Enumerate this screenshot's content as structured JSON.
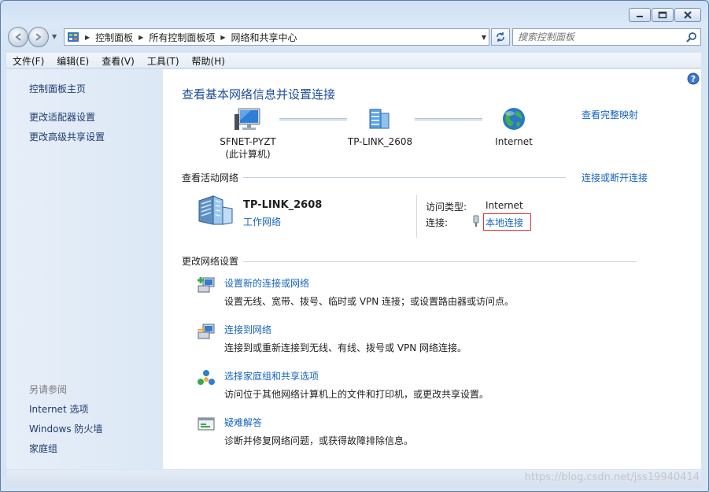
{
  "window": {
    "caption_buttons": [
      "minimize",
      "maximize",
      "close"
    ]
  },
  "address": {
    "crumbs": [
      "控制面板",
      "所有控制面板项",
      "网络和共享中心"
    ],
    "search_placeholder": "搜索控制面板"
  },
  "menu": [
    "文件(F)",
    "编辑(E)",
    "查看(V)",
    "工具(T)",
    "帮助(H)"
  ],
  "sidebar": {
    "links": [
      "控制面板主页",
      "更改适配器设置",
      "更改高级共享设置"
    ],
    "see_also_label": "另请参阅",
    "see_also": [
      "Internet 选项",
      "Windows 防火墙",
      "家庭组"
    ]
  },
  "main": {
    "title": "查看基本网络信息并设置连接",
    "full_map_link": "查看完整映射",
    "map": {
      "computer_name": "SFNET-PYZT",
      "computer_sub": "(此计算机)",
      "network_name": "TP-LINK_2608",
      "internet_label": "Internet"
    },
    "active": {
      "heading": "查看活动网络",
      "connect_link": "连接或断开连接",
      "network_name": "TP-LINK_2608",
      "network_type": "工作网络",
      "access_type_label": "访问类型:",
      "access_type_value": "Internet",
      "connections_label": "连接:",
      "connection_link": "本地连接"
    },
    "change": {
      "heading": "更改网络设置",
      "tasks": [
        {
          "title": "设置新的连接或网络",
          "desc": "设置无线、宽带、拨号、临时或 VPN 连接；或设置路由器或访问点。"
        },
        {
          "title": "连接到网络",
          "desc": "连接到或重新连接到无线、有线、拨号或 VPN 网络连接。"
        },
        {
          "title": "选择家庭组和共享选项",
          "desc": "访问位于其他网络计算机上的文件和打印机，或更改共享设置。"
        },
        {
          "title": "疑难解答",
          "desc": "诊断并修复网络问题，或获得故障排除信息。"
        }
      ]
    }
  },
  "watermark": "https://blog.csdn.net/jss19940414"
}
